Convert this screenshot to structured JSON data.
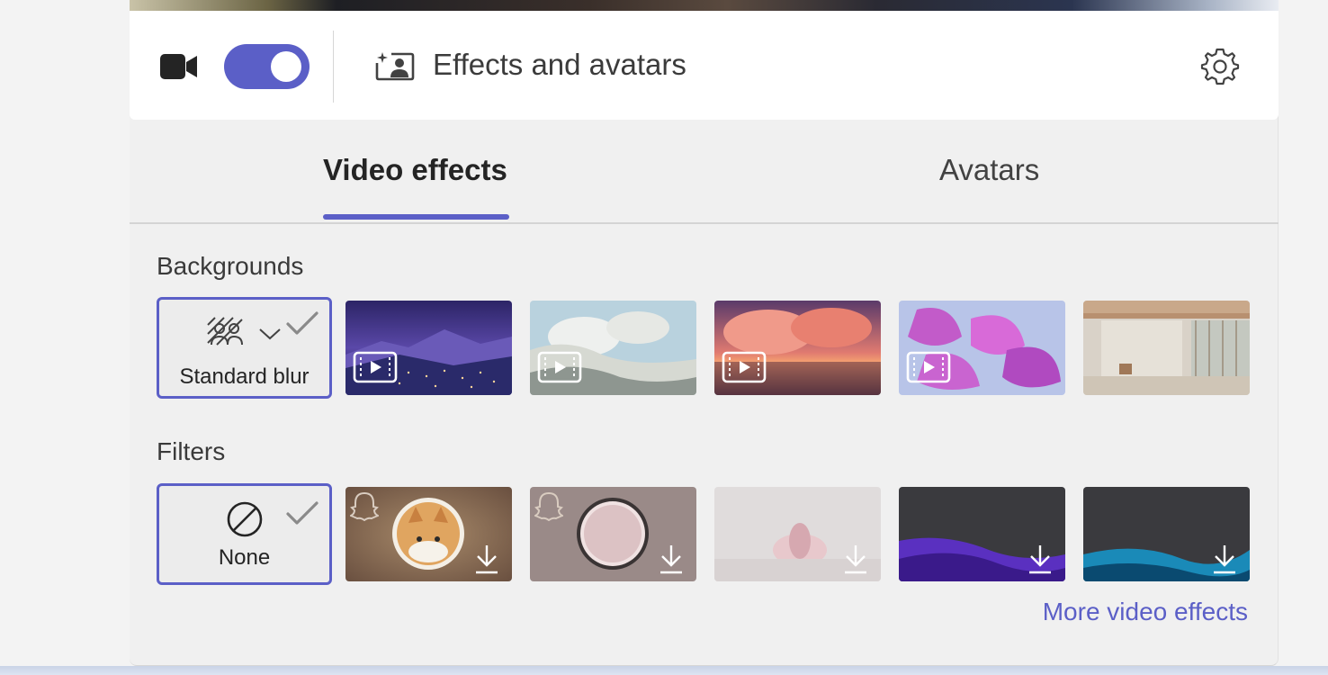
{
  "header": {
    "title": "Effects and avatars",
    "camera_on": true
  },
  "tabs": [
    {
      "label": "Video effects",
      "active": true
    },
    {
      "label": "Avatars",
      "active": false
    }
  ],
  "backgrounds": {
    "title": "Backgrounds",
    "items": [
      {
        "label": "Standard blur",
        "selected": true
      },
      {
        "label": "",
        "selected": false
      },
      {
        "label": "",
        "selected": false
      },
      {
        "label": "",
        "selected": false
      },
      {
        "label": "",
        "selected": false
      },
      {
        "label": "",
        "selected": false
      }
    ]
  },
  "filters": {
    "title": "Filters",
    "items": [
      {
        "label": "None",
        "selected": true
      },
      {
        "label": "",
        "selected": false
      },
      {
        "label": "",
        "selected": false
      },
      {
        "label": "",
        "selected": false
      },
      {
        "label": "",
        "selected": false
      },
      {
        "label": "",
        "selected": false
      }
    ]
  },
  "links": {
    "more_effects": "More video effects"
  },
  "colors": {
    "accent": "#5b5fc7",
    "panel_bg": "#f0f0f0",
    "header_bg": "#ffffff"
  },
  "icons": {
    "camera": "video-camera-icon",
    "effects": "effects-avatars-icon",
    "settings": "gear-icon",
    "blur": "blur-icon",
    "none": "none-icon",
    "selected": "checkmark-icon",
    "animated": "play-badge-icon",
    "download": "download-icon",
    "snapchat": "snapchat-ghost-icon"
  }
}
